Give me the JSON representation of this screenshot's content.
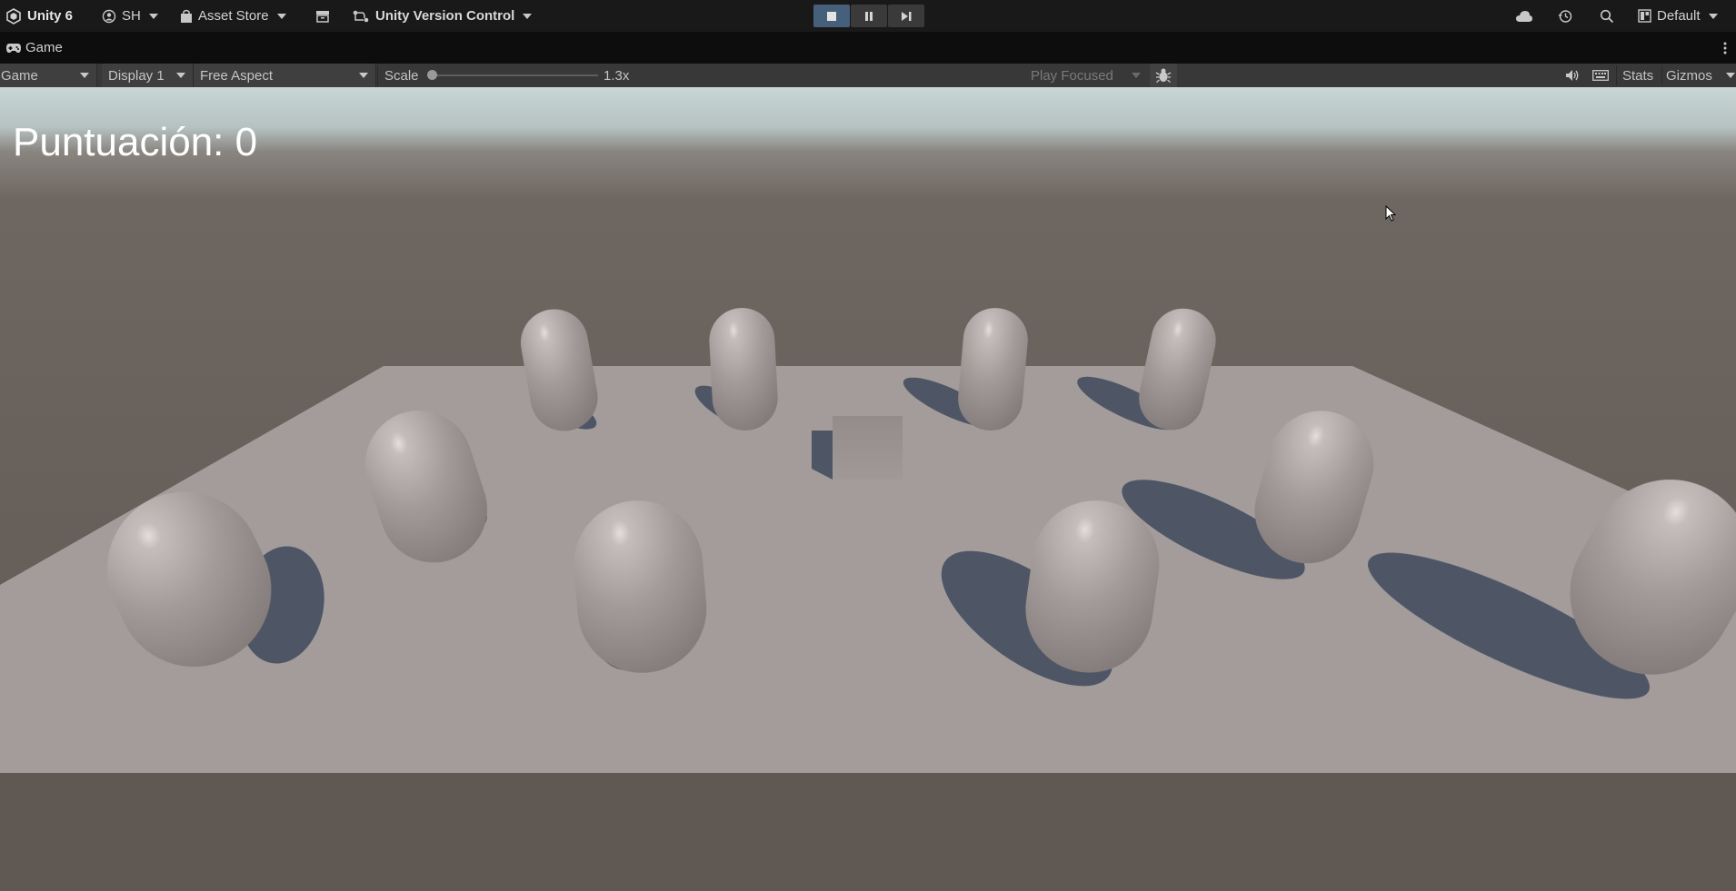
{
  "topbar": {
    "app_name": "Unity 6",
    "account": "SH",
    "asset_store": "Asset Store",
    "version_control": "Unity Version Control",
    "layout": "Default"
  },
  "panel": {
    "tab_title": "Game"
  },
  "toolbar": {
    "mode": "Game",
    "display": "Display 1",
    "aspect": "Free Aspect",
    "scale_label": "Scale",
    "scale_value": "1.3x",
    "scale_level": 0,
    "play_mode": "Play Focused",
    "stats": "Stats",
    "gizmos": "Gizmos"
  },
  "game": {
    "score_text": "Puntuación: 0"
  },
  "colors": {
    "toolbar_bg": "#383838",
    "topbar_bg": "#191919",
    "tab_bg": "#0d0d0d",
    "play_active": "#46607c",
    "ground": "#a39c9b",
    "capsule": "#a8a19f",
    "shadow": "#3f4a5c"
  },
  "icons": [
    "unity-logo-icon",
    "account-icon",
    "asset-store-bag-icon",
    "package-icon",
    "version-control-icon",
    "stop-icon",
    "pause-icon",
    "step-icon",
    "cloud-icon",
    "history-icon",
    "search-icon",
    "layout-icon",
    "gamepad-icon",
    "more-icon",
    "bug-icon",
    "audio-icon",
    "keyboard-icon",
    "cursor-icon"
  ]
}
